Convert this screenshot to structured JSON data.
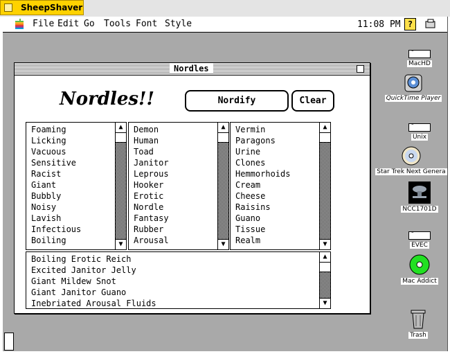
{
  "host": {
    "title": "SheepShaver"
  },
  "menubar": {
    "items": [
      "File",
      "Edit",
      "Go",
      "Tools",
      "Font",
      "Style"
    ],
    "clock": "11:08 PM",
    "help_glyph": "?"
  },
  "desktop": {
    "icons": [
      {
        "label": "MacHD",
        "icon": "hard-disk-icon"
      },
      {
        "label": "QuickTime Player",
        "icon": "quicktime-icon"
      },
      {
        "label": "Unix",
        "icon": "hard-disk-icon"
      },
      {
        "label": "Star Trek Next Genera",
        "icon": "cd-icon"
      },
      {
        "label": "NCC1701D",
        "icon": "starship-icon"
      },
      {
        "label": "EVEC",
        "icon": "hard-disk-icon"
      },
      {
        "label": "Mac Addict",
        "icon": "cd-icon"
      },
      {
        "label": "Trash",
        "icon": "trash-icon"
      }
    ]
  },
  "window": {
    "title": "Nordles",
    "heading": "Nordles!!",
    "nordify_label": "Nordify",
    "clear_label": "Clear",
    "list1": [
      "Foaming",
      "Licking",
      "Vacuous",
      "Sensitive",
      "Racist",
      "Giant",
      "Bubbly",
      "Noisy",
      "Lavish",
      "Infectious",
      "Boiling"
    ],
    "list2": [
      "Demon",
      "Human",
      "Toad",
      "Janitor",
      "Leprous",
      "Hooker",
      "Erotic",
      "Nordle",
      "Fantasy",
      "Rubber",
      "Arousal"
    ],
    "list3": [
      "Vermin",
      "Paragons",
      "Urine",
      "Clones",
      "Hemmorhoids",
      "Cream",
      "Cheese",
      "Raisins",
      "Guano",
      "Tissue",
      "Realm"
    ],
    "results": [
      "Boiling Erotic Reich",
      "Excited Janitor Jelly",
      "Giant Mildew Snot",
      "Giant Janitor Guano",
      "Inebriated Arousal Fluids"
    ]
  },
  "colors": {
    "host_tab": "#ffd200",
    "desktop": "#a9a9a9",
    "cd_green": "#22e022"
  }
}
